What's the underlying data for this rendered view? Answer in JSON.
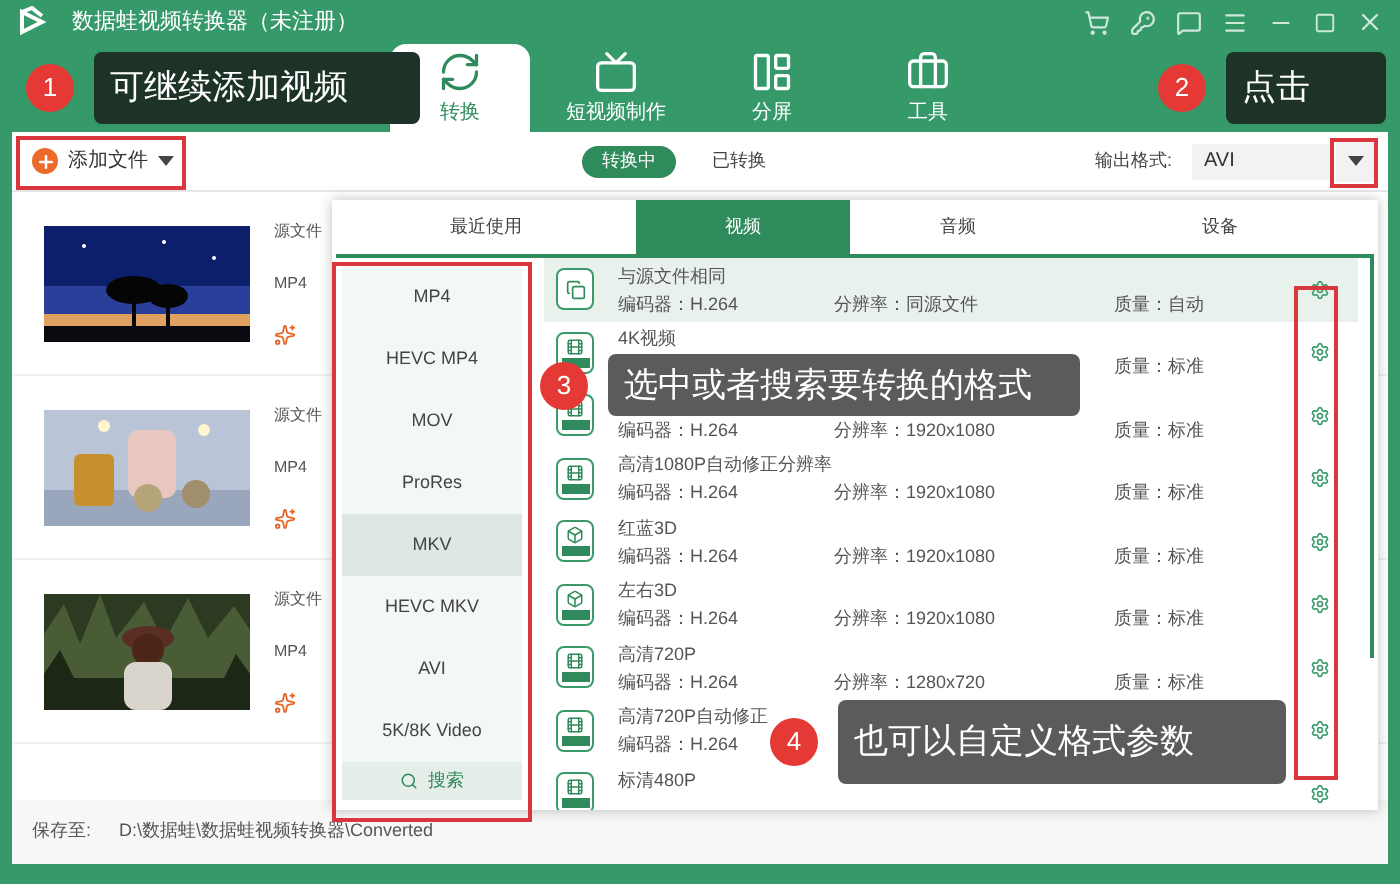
{
  "window": {
    "title": "数据蛙视频转换器（未注册）"
  },
  "main_tabs": [
    {
      "label": "转换",
      "selected": true,
      "kind": "convert"
    },
    {
      "label": "短视频制作",
      "selected": false,
      "kind": "tv"
    },
    {
      "label": "分屏",
      "selected": false,
      "kind": "split"
    },
    {
      "label": "工具",
      "selected": false,
      "kind": "tools"
    }
  ],
  "toolbar": {
    "add_button": "添加文件",
    "segments": [
      {
        "label": "转换中",
        "selected": true
      },
      {
        "label": "已转换",
        "selected": false
      }
    ],
    "output_format_label": "输出格式:",
    "output_format_value": "AVI"
  },
  "files": [
    {
      "source_label": "源文件",
      "format": "MP4",
      "kind": "night"
    },
    {
      "source_label": "源文件",
      "format": "MP4",
      "kind": "candles"
    },
    {
      "source_label": "源文件",
      "format": "MP4",
      "kind": "field"
    }
  ],
  "save_bar": {
    "label": "保存至:",
    "path": "D:\\数据蛙\\数据蛙视频转换器\\Converted"
  },
  "format_panel": {
    "tabs": [
      {
        "label": "最近使用",
        "selected": false
      },
      {
        "label": "视频",
        "selected": true
      },
      {
        "label": "音频",
        "selected": false
      },
      {
        "label": "设备",
        "selected": false
      }
    ],
    "formats": [
      {
        "label": "MP4",
        "selected": false
      },
      {
        "label": "HEVC MP4",
        "selected": false
      },
      {
        "label": "MOV",
        "selected": false
      },
      {
        "label": "ProRes",
        "selected": false
      },
      {
        "label": "MKV",
        "selected": true
      },
      {
        "label": "HEVC MKV",
        "selected": false
      },
      {
        "label": "AVI",
        "selected": false
      },
      {
        "label": "5K/8K Video",
        "selected": false
      }
    ],
    "search": "搜索",
    "presets": [
      {
        "name": "与源文件相同",
        "codec": "编码器：H.264",
        "resolution": "分辨率：同源文件",
        "quality": "质量：自动",
        "selected": true,
        "kind": "copy"
      },
      {
        "name": "4K视频",
        "quality": "质量：标准",
        "selected": false,
        "kind": "hd"
      },
      {
        "codec": "编码器：H.264",
        "resolution": "分辨率：1920x1080",
        "quality": "质量：标准",
        "selected": false,
        "kind": "hd"
      },
      {
        "name": "高清1080P自动修正分辨率",
        "codec": "编码器：H.264",
        "resolution": "分辨率：1920x1080",
        "quality": "质量：标准",
        "selected": false,
        "kind": "hd"
      },
      {
        "name": "红蓝3D",
        "codec": "编码器：H.264",
        "resolution": "分辨率：1920x1080",
        "quality": "质量：标准",
        "selected": false,
        "kind": "cube"
      },
      {
        "name": "左右3D",
        "codec": "编码器：H.264",
        "resolution": "分辨率：1920x1080",
        "quality": "质量：标准",
        "selected": false,
        "kind": "cube"
      },
      {
        "name": "高清720P",
        "codec": "编码器：H.264",
        "resolution": "分辨率：1280x720",
        "quality": "质量：标准",
        "selected": false,
        "kind": "hd"
      },
      {
        "name": "高清720P自动修正",
        "codec": "编码器：H.264",
        "selected": false,
        "kind": "hd"
      },
      {
        "name": "标清480P",
        "selected": false,
        "kind": "hd"
      }
    ]
  },
  "annotations": [
    {
      "number": "1",
      "text": "可继续添加视频",
      "kind": "dark"
    },
    {
      "number": "2",
      "text": "点击",
      "kind": "dark"
    },
    {
      "number": "3",
      "text": "选中或者搜索要转换的格式",
      "kind": "gray"
    },
    {
      "number": "4",
      "text": "也可以自定义格式参数",
      "kind": "gray"
    }
  ]
}
